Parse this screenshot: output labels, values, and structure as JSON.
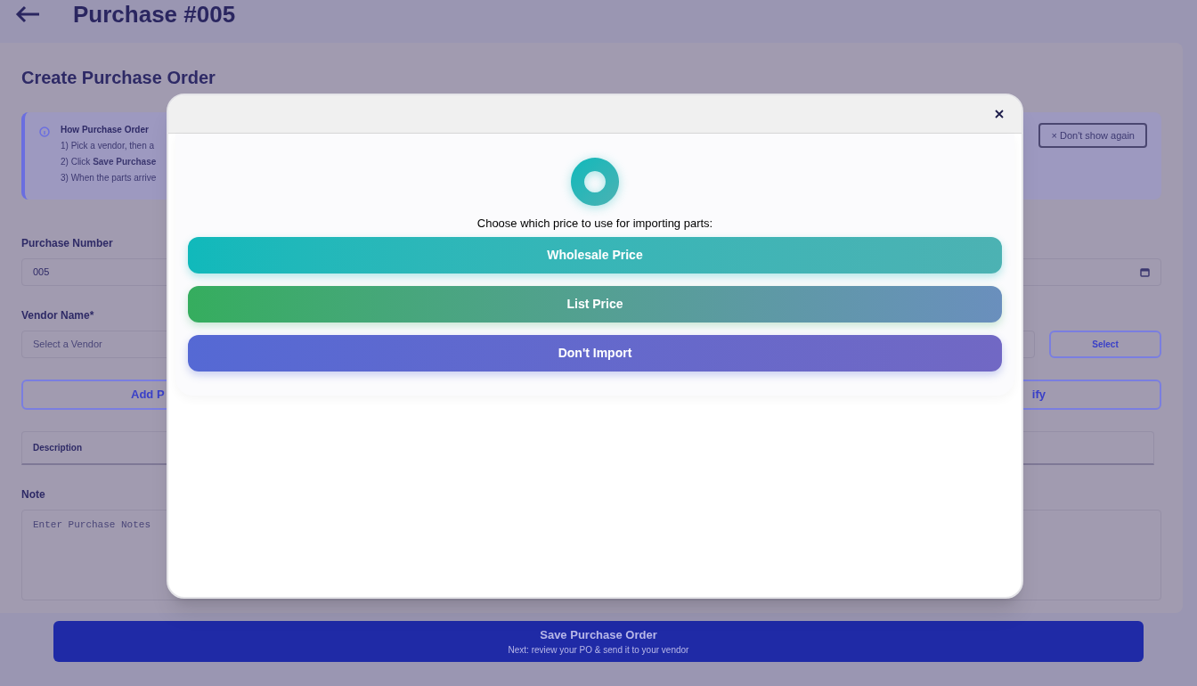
{
  "header": {
    "title": "Purchase #005"
  },
  "form": {
    "title": "Create Purchase Order",
    "info": {
      "heading": "How Purchase Order",
      "lines": [
        "1) Pick a vendor, then a",
        "2) Click **Save Purchase**",
        "3) When the parts arrive"
      ],
      "dismiss": "× Don't show again"
    },
    "purchase_number": {
      "label": "Purchase Number",
      "value": "005"
    },
    "vendor": {
      "label": "Vendor Name*",
      "placeholder": "Select a Vendor",
      "button": "Select"
    },
    "actions": [
      "Add P",
      "ify"
    ],
    "table": {
      "columns": [
        "Description"
      ]
    },
    "note": {
      "label": "Note",
      "placeholder": "Enter Purchase Notes"
    }
  },
  "save": {
    "label": "Save Purchase Order",
    "hint": "Next: review your PO & send it to your vendor"
  },
  "dialog": {
    "prompt": "Choose which price to use for importing parts:",
    "options": [
      {
        "label": "Wholesale Price",
        "kind": "wholesale"
      },
      {
        "label": "List Price",
        "kind": "list"
      },
      {
        "label": "Don't Import",
        "kind": "skip"
      }
    ]
  }
}
